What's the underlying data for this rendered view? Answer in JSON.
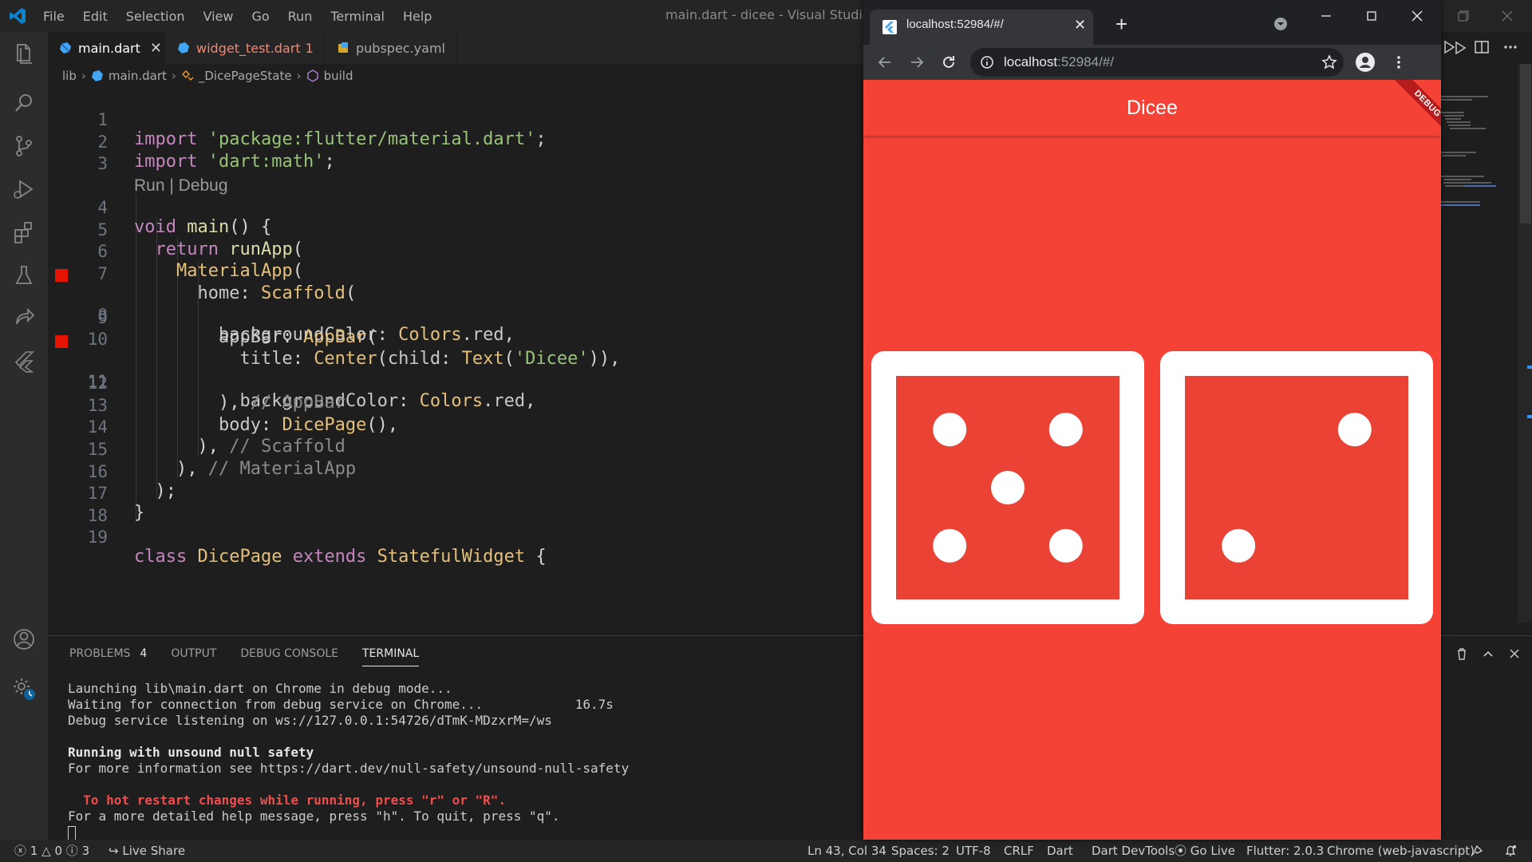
{
  "vscode": {
    "menu": [
      "File",
      "Edit",
      "Selection",
      "View",
      "Go",
      "Run",
      "Terminal",
      "Help"
    ],
    "window_title": "main.dart - dicee - Visual Studio Code",
    "tabs": [
      {
        "label": "main.dart",
        "close": "✕"
      },
      {
        "label": "widget_test.dart",
        "badge": "1"
      },
      {
        "label": "pubspec.yaml"
      }
    ],
    "breadcrumb": [
      "lib",
      "main.dart",
      "_DicePageState",
      "build"
    ],
    "code_lens": "Run | Debug",
    "line_numbers": [
      "1",
      "2",
      "3",
      "4",
      "5",
      "6",
      "7",
      "8",
      "9",
      "10",
      "11",
      "12",
      "13",
      "14",
      "15",
      "16",
      "17",
      "18",
      "19"
    ],
    "breakpoint_lines": [
      "8",
      "11"
    ],
    "panel": {
      "tabs": [
        "PROBLEMS",
        "OUTPUT",
        "DEBUG CONSOLE",
        "TERMINAL"
      ],
      "problems_count": "4",
      "active_tab": "TERMINAL",
      "terminal_lines": [
        "Launching lib\\main.dart on Chrome in debug mode...",
        "Waiting for connection from debug service on Chrome...            16.7s",
        "Debug service listening on ws://127.0.0.1:54726/dTmK-MDzxrM=/ws",
        "",
        "Running with unsound null safety",
        "For more information see https://dart.dev/null-safety/unsound-null-safety",
        "",
        "  To hot restart changes while running, press \"r\" or \"R\".",
        "For a more detailed help message, press \"h\". To quit, press \"q\"."
      ]
    },
    "statusbar": {
      "errors": "1",
      "warnings": "0",
      "info": "3",
      "live_share": "Live Share",
      "position": "Ln 43, Col 34",
      "spaces": "Spaces: 2",
      "encoding": "UTF-8",
      "eol": "CRLF",
      "language": "Dart",
      "devtools": "Dart DevTools",
      "go_live": "Go Live",
      "flutter": "Flutter: 2.0.3",
      "device": "Chrome (web-javascript)"
    }
  },
  "browser": {
    "tab_title": "localhost:52984/#/",
    "tab_close": "✕",
    "new_tab": "+",
    "url_host": "localhost",
    "url_rest": ":52984/#/",
    "app_title": "Dicee",
    "debug_banner": "DEBUG",
    "colors": {
      "app_background": "#f44336",
      "dice_face": "#ea4335",
      "pip": "#ffffff"
    },
    "dice": [
      {
        "value": 5,
        "name": "left-die"
      },
      {
        "value": 2,
        "name": "right-die"
      }
    ]
  }
}
